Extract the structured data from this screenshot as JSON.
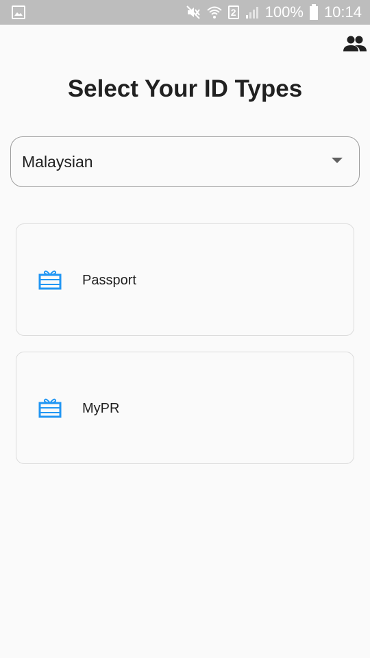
{
  "status_bar": {
    "battery": "100%",
    "time": "10:14",
    "sim_slot": "2"
  },
  "header": {
    "title": "Select Your ID Types"
  },
  "nationality_dropdown": {
    "selected": "Malaysian"
  },
  "id_types": [
    {
      "label": "Passport",
      "icon": "id-card-icon"
    },
    {
      "label": "MyPR",
      "icon": "id-card-icon"
    }
  ],
  "colors": {
    "accent": "#2196f3",
    "status_bar": "#bdbdbd",
    "background": "#fafafa"
  }
}
